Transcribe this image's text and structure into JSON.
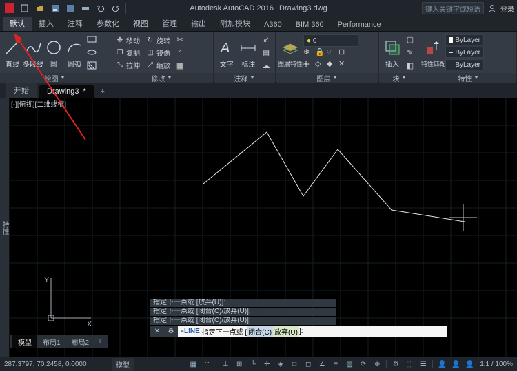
{
  "title": {
    "app": "Autodesk AutoCAD 2016",
    "file": "Drawing3.dwg"
  },
  "search_placeholder": "键入关键字或短语",
  "login_text": "登录",
  "tabs": [
    "默认",
    "插入",
    "注释",
    "参数化",
    "视图",
    "管理",
    "输出",
    "附加模块",
    "A360",
    "BIM 360",
    "Performance"
  ],
  "panels": {
    "draw": {
      "title": "绘图",
      "line": "直线",
      "polyline": "多段线",
      "circle": "圆",
      "arc": "圆弧"
    },
    "modify": {
      "title": "修改",
      "move": "移动",
      "rotate": "旋转",
      "copy": "复制",
      "mirror": "镜像",
      "stretch": "拉伸",
      "scale": "缩放"
    },
    "annotation": {
      "title": "注释",
      "text": "文字",
      "dim": "标注"
    },
    "layers": {
      "title": "图层",
      "btn": "图层特性",
      "current": "0"
    },
    "block": {
      "title": "块",
      "insert": "插入"
    },
    "properties": {
      "title": "特性",
      "match": "特性匹配",
      "bylayer": "ByLayer"
    }
  },
  "filetabs": {
    "start": "开始",
    "active": "Drawing3",
    "modified": "*"
  },
  "viewport_label": "[-][俯视][二维线框]",
  "propbar_label": "特性",
  "cmdhistory": [
    "指定下一点或  [放弃(U)]:",
    "指定下一点或  [闭合(C)/放弃(U)]:",
    "指定下一点或  [闭合(C)/放弃(U)]:"
  ],
  "cmdline": {
    "prefix": "LINE",
    "text": "指定下一点或 [",
    "opt1": "闭合(C)",
    "mid": " ",
    "opt2": "放弃(U)",
    "suffix": "]:"
  },
  "modeltabs": {
    "model": "模型",
    "layout1": "布局1",
    "layout2": "布局2"
  },
  "status": {
    "coord": "287.3797, 70.2458, 0.0000",
    "model_tag": "模型",
    "zoom": "1:1 / 100%"
  },
  "chart_data": {
    "type": "line",
    "title": "",
    "note": "Freehand CAD polyline on model space; pixel coordinates approximate screen position in 730x354 canvas",
    "points": [
      [
        281,
        125
      ],
      [
        373,
        50
      ],
      [
        426,
        143
      ],
      [
        476,
        75
      ],
      [
        554,
        163
      ],
      [
        660,
        180
      ]
    ],
    "cursor": [
      658,
      174
    ]
  },
  "ucs": {
    "y_label": "Y",
    "x_label": "X"
  }
}
